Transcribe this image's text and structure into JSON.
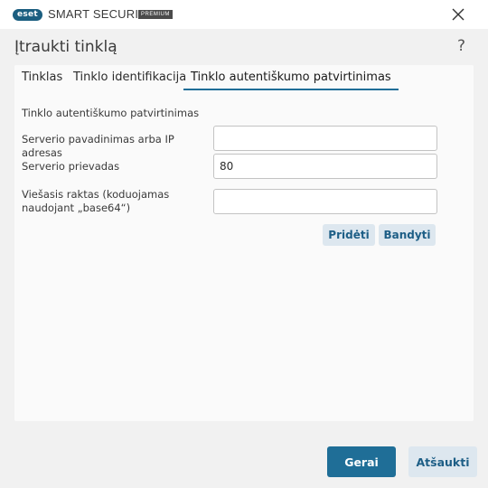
{
  "app": {
    "logo_text": "eset",
    "name": "SMART SECURITY",
    "edition": "PREMIUM"
  },
  "dialog": {
    "title": "Įtraukti tinklą",
    "help": "?"
  },
  "tabs": [
    {
      "label": "Tinklas",
      "active": false
    },
    {
      "label": "Tinklo identifikacija",
      "active": false
    },
    {
      "label": "Tinklo autentiškumo patvirtinimas",
      "active": true
    }
  ],
  "form": {
    "section_title": "Tinklo autentiškumo patvirtinimas",
    "server_name_label": "Serverio pavadinimas arba IP adresas",
    "server_name_value": "",
    "server_port_label": "Serverio prievadas",
    "server_port_value": "80",
    "public_key_label": "Viešasis raktas (koduojamas naudojant „base64“)",
    "public_key_value": "",
    "add_label": "Pridėti",
    "test_label": "Bandyti"
  },
  "footer": {
    "ok_label": "Gerai",
    "cancel_label": "Atšaukti"
  },
  "colors": {
    "accent": "#1f6e97",
    "secondary_button_bg": "#dde7ef",
    "secondary_button_text": "#1d5e86"
  }
}
